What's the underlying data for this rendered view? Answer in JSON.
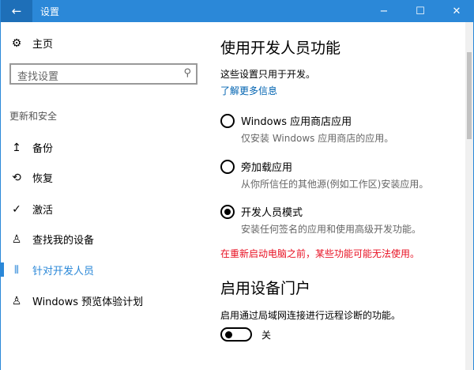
{
  "window": {
    "title": "设置",
    "back": "←",
    "minimize": "−",
    "maximize": "☐",
    "close": "✕"
  },
  "sidebar": {
    "home": "主页",
    "search_placeholder": "查找设置",
    "section": "更新和安全",
    "items": [
      {
        "label": "备份",
        "icon": "↥"
      },
      {
        "label": "恢复",
        "icon": "⟲"
      },
      {
        "label": "激活",
        "icon": "✓"
      },
      {
        "label": "查找我的设备",
        "icon": "♙"
      },
      {
        "label": "针对开发人员",
        "icon": "⫴"
      },
      {
        "label": "Windows 预览体验计划",
        "icon": "♙"
      }
    ]
  },
  "main": {
    "title": "使用开发人员功能",
    "subtitle": "这些设置只用于开发。",
    "link": "了解更多信息",
    "options": [
      {
        "label": "Windows 应用商店应用",
        "desc": "仅安装 Windows 应用商店的应用。",
        "selected": false
      },
      {
        "label": "旁加载应用",
        "desc": "从你所信任的其他源(例如工作区)安装应用。",
        "selected": false
      },
      {
        "label": "开发人员模式",
        "desc": "安装任何签名的应用和使用高级开发功能。",
        "selected": true
      }
    ],
    "warning": "在重新启动电脑之前，某些功能可能无法使用。",
    "portal_title": "启用设备门户",
    "portal_desc": "启用通过局域网连接进行远程诊断的功能。",
    "toggle_state": "关"
  },
  "colors": {
    "accent": "#2b88d8",
    "link": "#0063b1",
    "warning": "#e81123"
  }
}
